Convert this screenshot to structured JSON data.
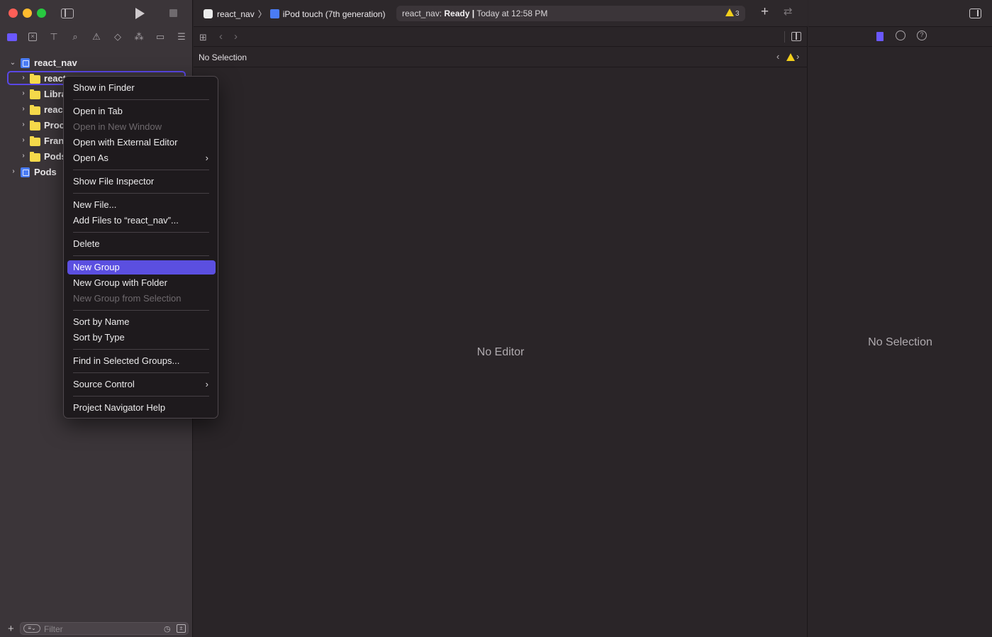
{
  "sidebar": {
    "tree": [
      {
        "label": "react_nav",
        "type": "project",
        "expanded": true
      },
      {
        "label": "react",
        "type": "folder"
      },
      {
        "label": "Libra",
        "type": "folder"
      },
      {
        "label": "reac",
        "type": "folder"
      },
      {
        "label": "Proc",
        "type": "folder"
      },
      {
        "label": "Fran",
        "type": "folder"
      },
      {
        "label": "Pods",
        "type": "folder"
      },
      {
        "label": "Pods",
        "type": "project"
      }
    ],
    "filter": {
      "placeholder": "Filter"
    }
  },
  "toolbar": {
    "scheme_name": "react_nav",
    "device_name": "iPod touch (7th generation)",
    "status_project": "react_nav:",
    "status_state": "Ready",
    "status_separator": "|",
    "status_time": "Today at 12:58 PM",
    "warning_count": "3"
  },
  "editor": {
    "jump_label": "No Selection",
    "placeholder": "No Editor"
  },
  "inspector": {
    "placeholder": "No Selection"
  },
  "context_menu": {
    "items": [
      {
        "label": "Show in Finder"
      },
      {
        "label": "Open in Tab"
      },
      {
        "label": "Open in New Window",
        "disabled": true
      },
      {
        "label": "Open with External Editor"
      },
      {
        "label": "Open As",
        "submenu": true
      },
      {
        "label": "Show File Inspector"
      },
      {
        "label": "New File..."
      },
      {
        "label": "Add Files to “react_nav”..."
      },
      {
        "label": "Delete"
      },
      {
        "label": "New Group",
        "highlighted": true
      },
      {
        "label": "New Group with Folder"
      },
      {
        "label": "New Group from Selection",
        "disabled": true
      },
      {
        "label": "Sort by Name"
      },
      {
        "label": "Sort by Type"
      },
      {
        "label": "Find in Selected Groups..."
      },
      {
        "label": "Source Control",
        "submenu": true
      },
      {
        "label": "Project Navigator Help"
      }
    ]
  },
  "colors": {
    "accent": "#5b4fe0",
    "folder": "#f5d94a",
    "warning": "#f3cf1b",
    "project_icon": "#4a7cf4"
  }
}
